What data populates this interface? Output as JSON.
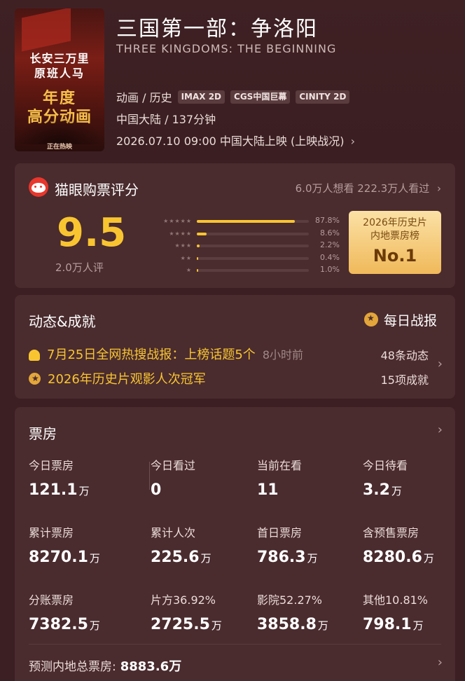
{
  "movie": {
    "title": "三国第一部：争洛阳",
    "title_en": "THREE KINGDOMS: THE BEGINNING",
    "genre": "动画 / 历史",
    "formats": [
      "IMAX 2D",
      "CGS中国巨幕",
      "CINITY 2D"
    ],
    "region_duration": "中国大陆 / 137分钟",
    "release": "2026.07.10 09:00 中国大陆上映 (上映战况)",
    "poster_text": {
      "line1": "长安三万里",
      "line2": "原班人马",
      "line3": "年度",
      "line4": "高分动画",
      "line5": "正在热映"
    }
  },
  "rating": {
    "title": "猫眼购票评分",
    "stats": "6.0万人想看  222.3万人看过",
    "score": "9.5",
    "count": "2.0万人评",
    "distribution": [
      {
        "stars": "★★★★★",
        "pct_label": "87.8%",
        "pct": 87.8
      },
      {
        "stars": "★★★★",
        "pct_label": "8.6%",
        "pct": 8.6
      },
      {
        "stars": "★★★",
        "pct_label": "2.2%",
        "pct": 2.2
      },
      {
        "stars": "★★",
        "pct_label": "0.4%",
        "pct": 0.4
      },
      {
        "stars": "★",
        "pct_label": "1.0%",
        "pct": 1.0
      }
    ],
    "rank_line1": "2026年历史片",
    "rank_line2": "内地票房榜",
    "rank_no": "No.1"
  },
  "news": {
    "title": "动态&成就",
    "daily_label": "每日战报",
    "item1": "7月25日全网热搜战报：上榜话题5个",
    "item1_time": "8小时前",
    "item1_count": "48条动态",
    "item2": "2026年历史片观影人次冠军",
    "item2_count": "15项成就"
  },
  "boxoffice": {
    "title": "票房",
    "rows": [
      [
        {
          "label": "今日票房",
          "value": "121.1",
          "unit": "万"
        },
        {
          "label": "今日看过",
          "value": "0",
          "unit": ""
        },
        {
          "label": "当前在看",
          "value": "11",
          "unit": ""
        },
        {
          "label": "今日待看",
          "value": "3.2",
          "unit": "万"
        }
      ],
      [
        {
          "label": "累计票房",
          "value": "8270.1",
          "unit": "万"
        },
        {
          "label": "累计人次",
          "value": "225.6",
          "unit": "万"
        },
        {
          "label": "首日票房",
          "value": "786.3",
          "unit": "万"
        },
        {
          "label": "含预售票房",
          "value": "8280.6",
          "unit": "万"
        }
      ],
      [
        {
          "label": "分账票房",
          "value": "7382.5",
          "unit": "万"
        },
        {
          "label": "片方36.92%",
          "value": "2725.5",
          "unit": "万"
        },
        {
          "label": "影院52.27%",
          "value": "3858.8",
          "unit": "万"
        },
        {
          "label": "其他10.81%",
          "value": "798.1",
          "unit": "万"
        }
      ]
    ],
    "forecast_label": "预测内地总票房:",
    "forecast_value": "8883.6万"
  },
  "colors": {
    "accent": "#f8c531",
    "background": "#3b1f22",
    "card": "#4a2b2e",
    "brand_red": "#e8372c"
  }
}
